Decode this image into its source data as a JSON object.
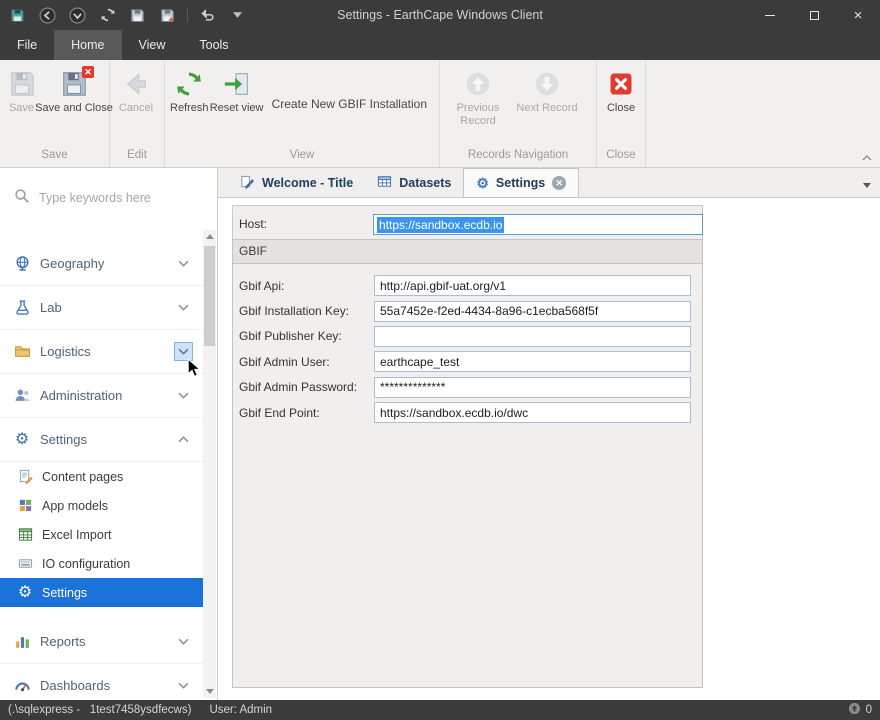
{
  "window": {
    "title": "Settings - EarthCape Windows Client"
  },
  "menu": {
    "tabs": [
      {
        "label": "File"
      },
      {
        "label": "Home"
      },
      {
        "label": "View"
      },
      {
        "label": "Tools"
      }
    ]
  },
  "ribbon": {
    "save_group": {
      "label": "Save",
      "save": "Save",
      "save_and_close": "Save and Close"
    },
    "edit_group": {
      "label": "Edit",
      "cancel": "Cancel"
    },
    "view_group": {
      "label": "View",
      "refresh": "Refresh",
      "reset_view": "Reset view",
      "create_gbif": "Create New GBIF Installation"
    },
    "records_group": {
      "label": "Records Navigation",
      "previous": "Previous Record",
      "next": "Next Record"
    },
    "close_group": {
      "label": "Close",
      "close": "Close"
    }
  },
  "sidebar": {
    "search_placeholder": "Type keywords here",
    "groups": [
      {
        "label": "Geography"
      },
      {
        "label": "Lab"
      },
      {
        "label": "Logistics"
      },
      {
        "label": "Administration"
      },
      {
        "label": "Settings"
      },
      {
        "label": "Reports"
      },
      {
        "label": "Dashboards"
      }
    ],
    "settings_items": [
      {
        "label": "Content pages"
      },
      {
        "label": "App models"
      },
      {
        "label": "Excel Import"
      },
      {
        "label": "IO configuration"
      },
      {
        "label": "Settings"
      }
    ]
  },
  "tabs": {
    "items": [
      {
        "label": "Welcome - Title"
      },
      {
        "label": "Datasets"
      },
      {
        "label": "Settings"
      }
    ]
  },
  "form": {
    "host_label": "Host:",
    "host_value": "https://sandbox.ecdb.io",
    "group_title": "GBIF",
    "fields": [
      {
        "label": "Gbif Api:",
        "value": "http://api.gbif-uat.org/v1"
      },
      {
        "label": "Gbif Installation Key:",
        "value": "55a7452e-f2ed-4434-8a96-c1ecba568f5f"
      },
      {
        "label": "Gbif Publisher Key:",
        "value": ""
      },
      {
        "label": "Gbif Admin User:",
        "value": "earthcape_test"
      },
      {
        "label": "Gbif Admin Password:",
        "value": "**************"
      },
      {
        "label": "Gbif End Point:",
        "value": "https://sandbox.ecdb.io/dwc"
      }
    ]
  },
  "statusbar": {
    "connection": "(.\\sqlexpress -   1test7458ysdfecws)",
    "user": "User: Admin",
    "counter": "0"
  }
}
